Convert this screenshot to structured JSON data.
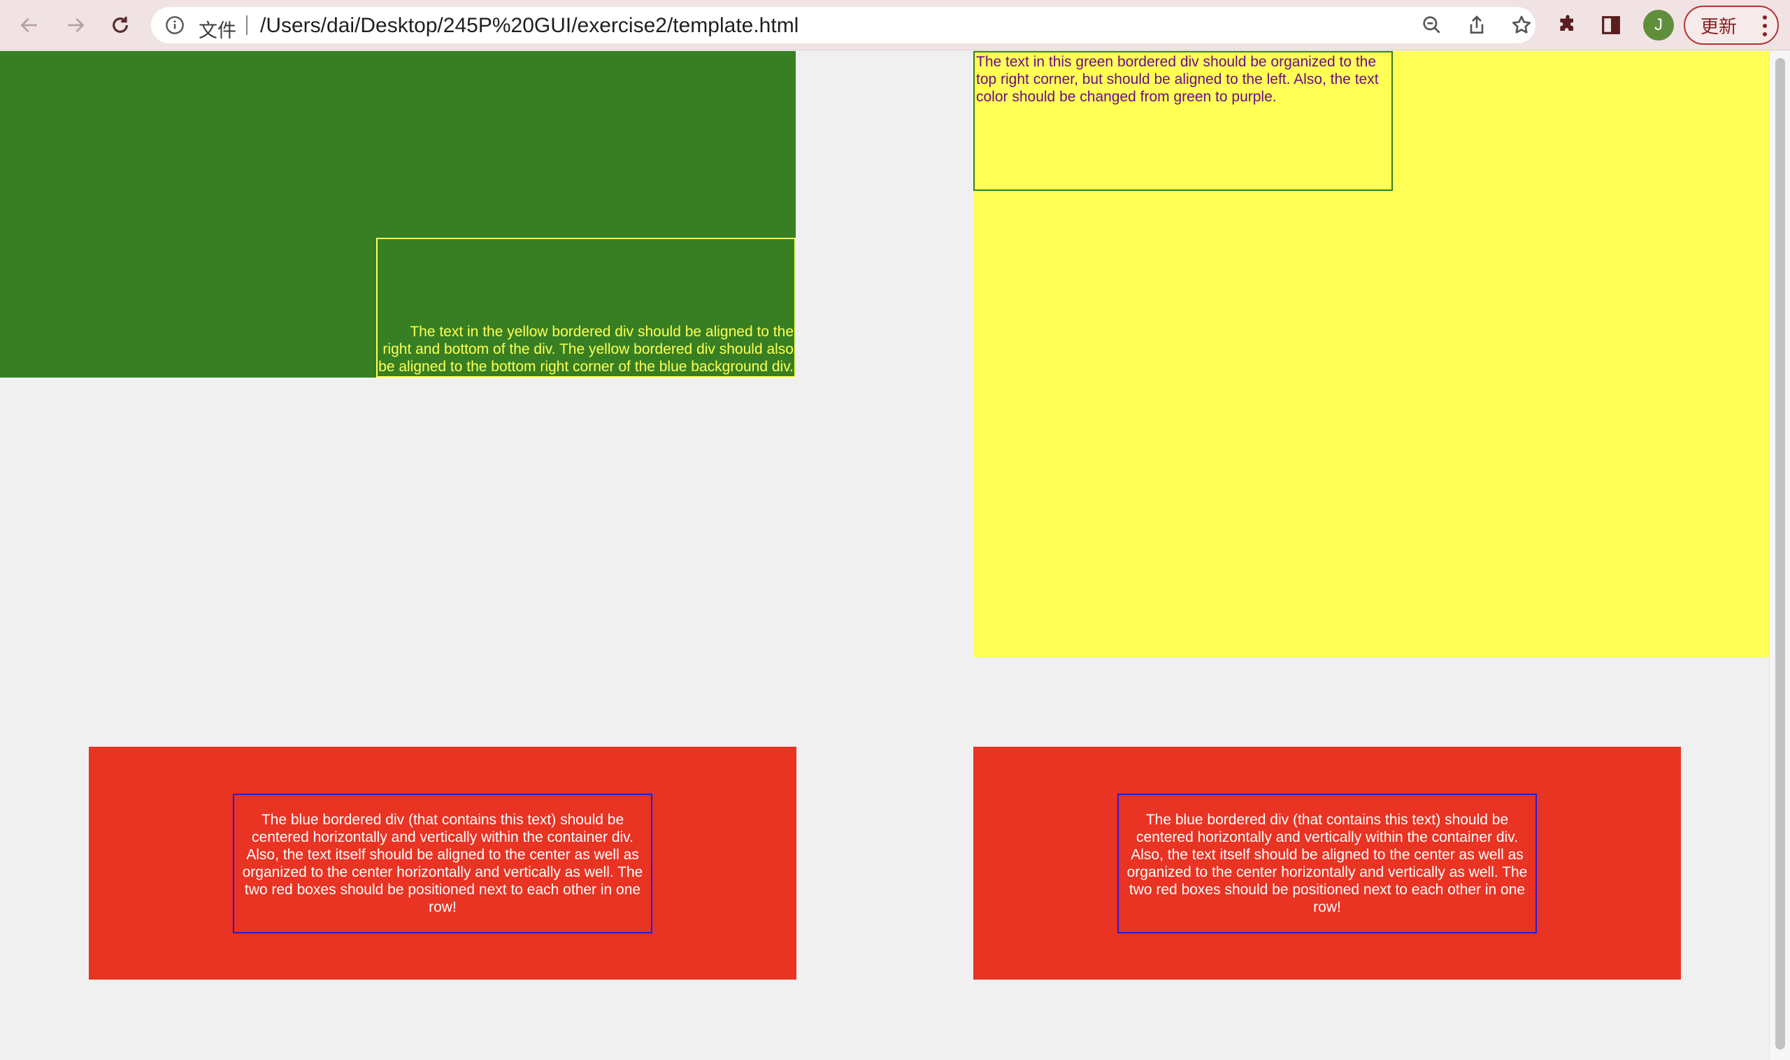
{
  "browser": {
    "scheme_label": "文件",
    "url": "/Users/dai/Desktop/245P%20GUI/exercise2/template.html",
    "avatar_initial": "J",
    "update_label": "更新",
    "icons": {
      "back": "back-arrow-icon",
      "forward": "forward-arrow-icon",
      "reload": "reload-icon",
      "site_info": "info-icon",
      "zoom": "zoom-out-icon",
      "share": "share-icon",
      "bookmark": "star-icon",
      "extensions": "puzzle-icon",
      "side_panel": "side-panel-icon",
      "menu": "kebab-menu-icon"
    }
  },
  "page": {
    "yellow_box_text": "The text in the yellow bordered div should be aligned to the right and bottom of the div. The yellow bordered div should also be aligned to the bottom right corner of the blue background div.",
    "green_box_text": "The text in this green bordered div should be organized to the top right corner, but should be aligned to the left. Also, the text color should be changed from green to purple.",
    "blue_box_left_text": "The blue bordered div (that contains this text) should be centered horizontally and vertically within the container div. Also, the text itself should be aligned to the center as well as organized to the center horizontally and vertically as well. The two red boxes should be positioned next to each other in one row!",
    "blue_box_right_text": "The blue bordered div (that contains this text) should be centered horizontally and vertically within the container div. Also, the text itself should be aligned to the center as well as organized to the center horizontally and vertically as well. The two red boxes should be positioned next to each other in one row!"
  },
  "colors": {
    "green": "#377f22",
    "yellow": "#ffff55",
    "red": "#e93323",
    "blue_border": "#2a1bd6",
    "purple_text": "#6b0d88"
  }
}
